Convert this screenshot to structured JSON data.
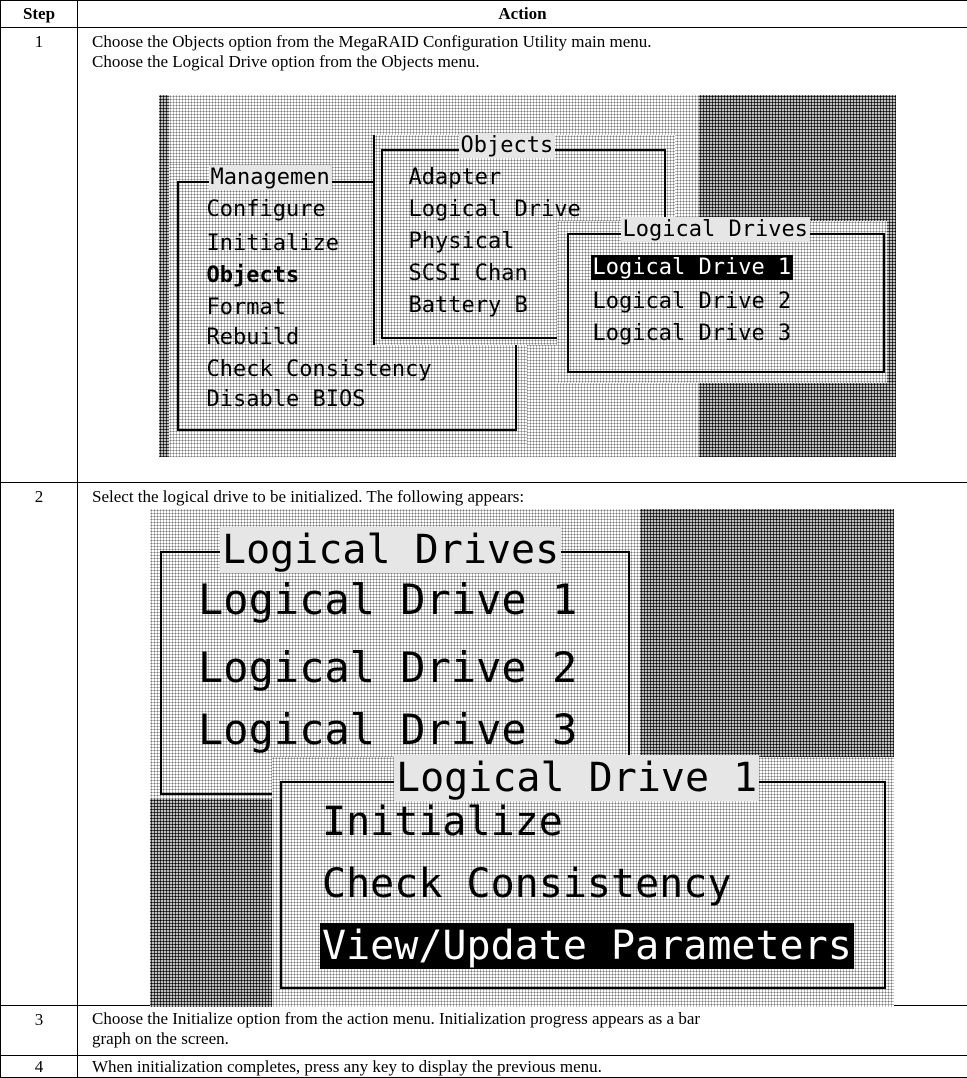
{
  "header": {
    "step": "Step",
    "action": "Action"
  },
  "steps": [
    {
      "num": "1",
      "lines": [
        "Choose the Objects option from the MegaRAID Configuration Utility main menu.",
        "Choose the Logical Drive option from the Objects menu."
      ],
      "screen": {
        "management_title": "Managemen",
        "management_items": [
          "Configure",
          "Initialize",
          "Objects",
          "Format",
          "Rebuild",
          "Check Consistency",
          "Disable BIOS"
        ],
        "objects_title": "Objects",
        "objects_items": [
          "Adapter",
          "Logical Drive",
          "Physical",
          "SCSI Chan",
          "Battery B"
        ],
        "drives_title": "Logical Drives",
        "drives_items": [
          "Logical Drive 1",
          "Logical Drive 2",
          "Logical Drive 3"
        ]
      }
    },
    {
      "num": "2",
      "lines": [
        "Select the logical drive to be initialized. The following appears:"
      ],
      "screen": {
        "drives_title": "Logical Drives",
        "drives_items": [
          "Logical Drive 1",
          "Logical Drive 2",
          "Logical Drive 3"
        ],
        "action_title": "Logical Drive 1",
        "action_items": [
          "Initialize",
          "Check Consistency",
          "View/Update Parameters"
        ]
      }
    },
    {
      "num": "3",
      "lines": [
        "Choose the Initialize option from the action menu. Initialization progress appears as a bar",
        "graph on the screen."
      ]
    },
    {
      "num": "4",
      "lines": [
        "When initialization completes, press any key to display the previous menu."
      ]
    }
  ]
}
